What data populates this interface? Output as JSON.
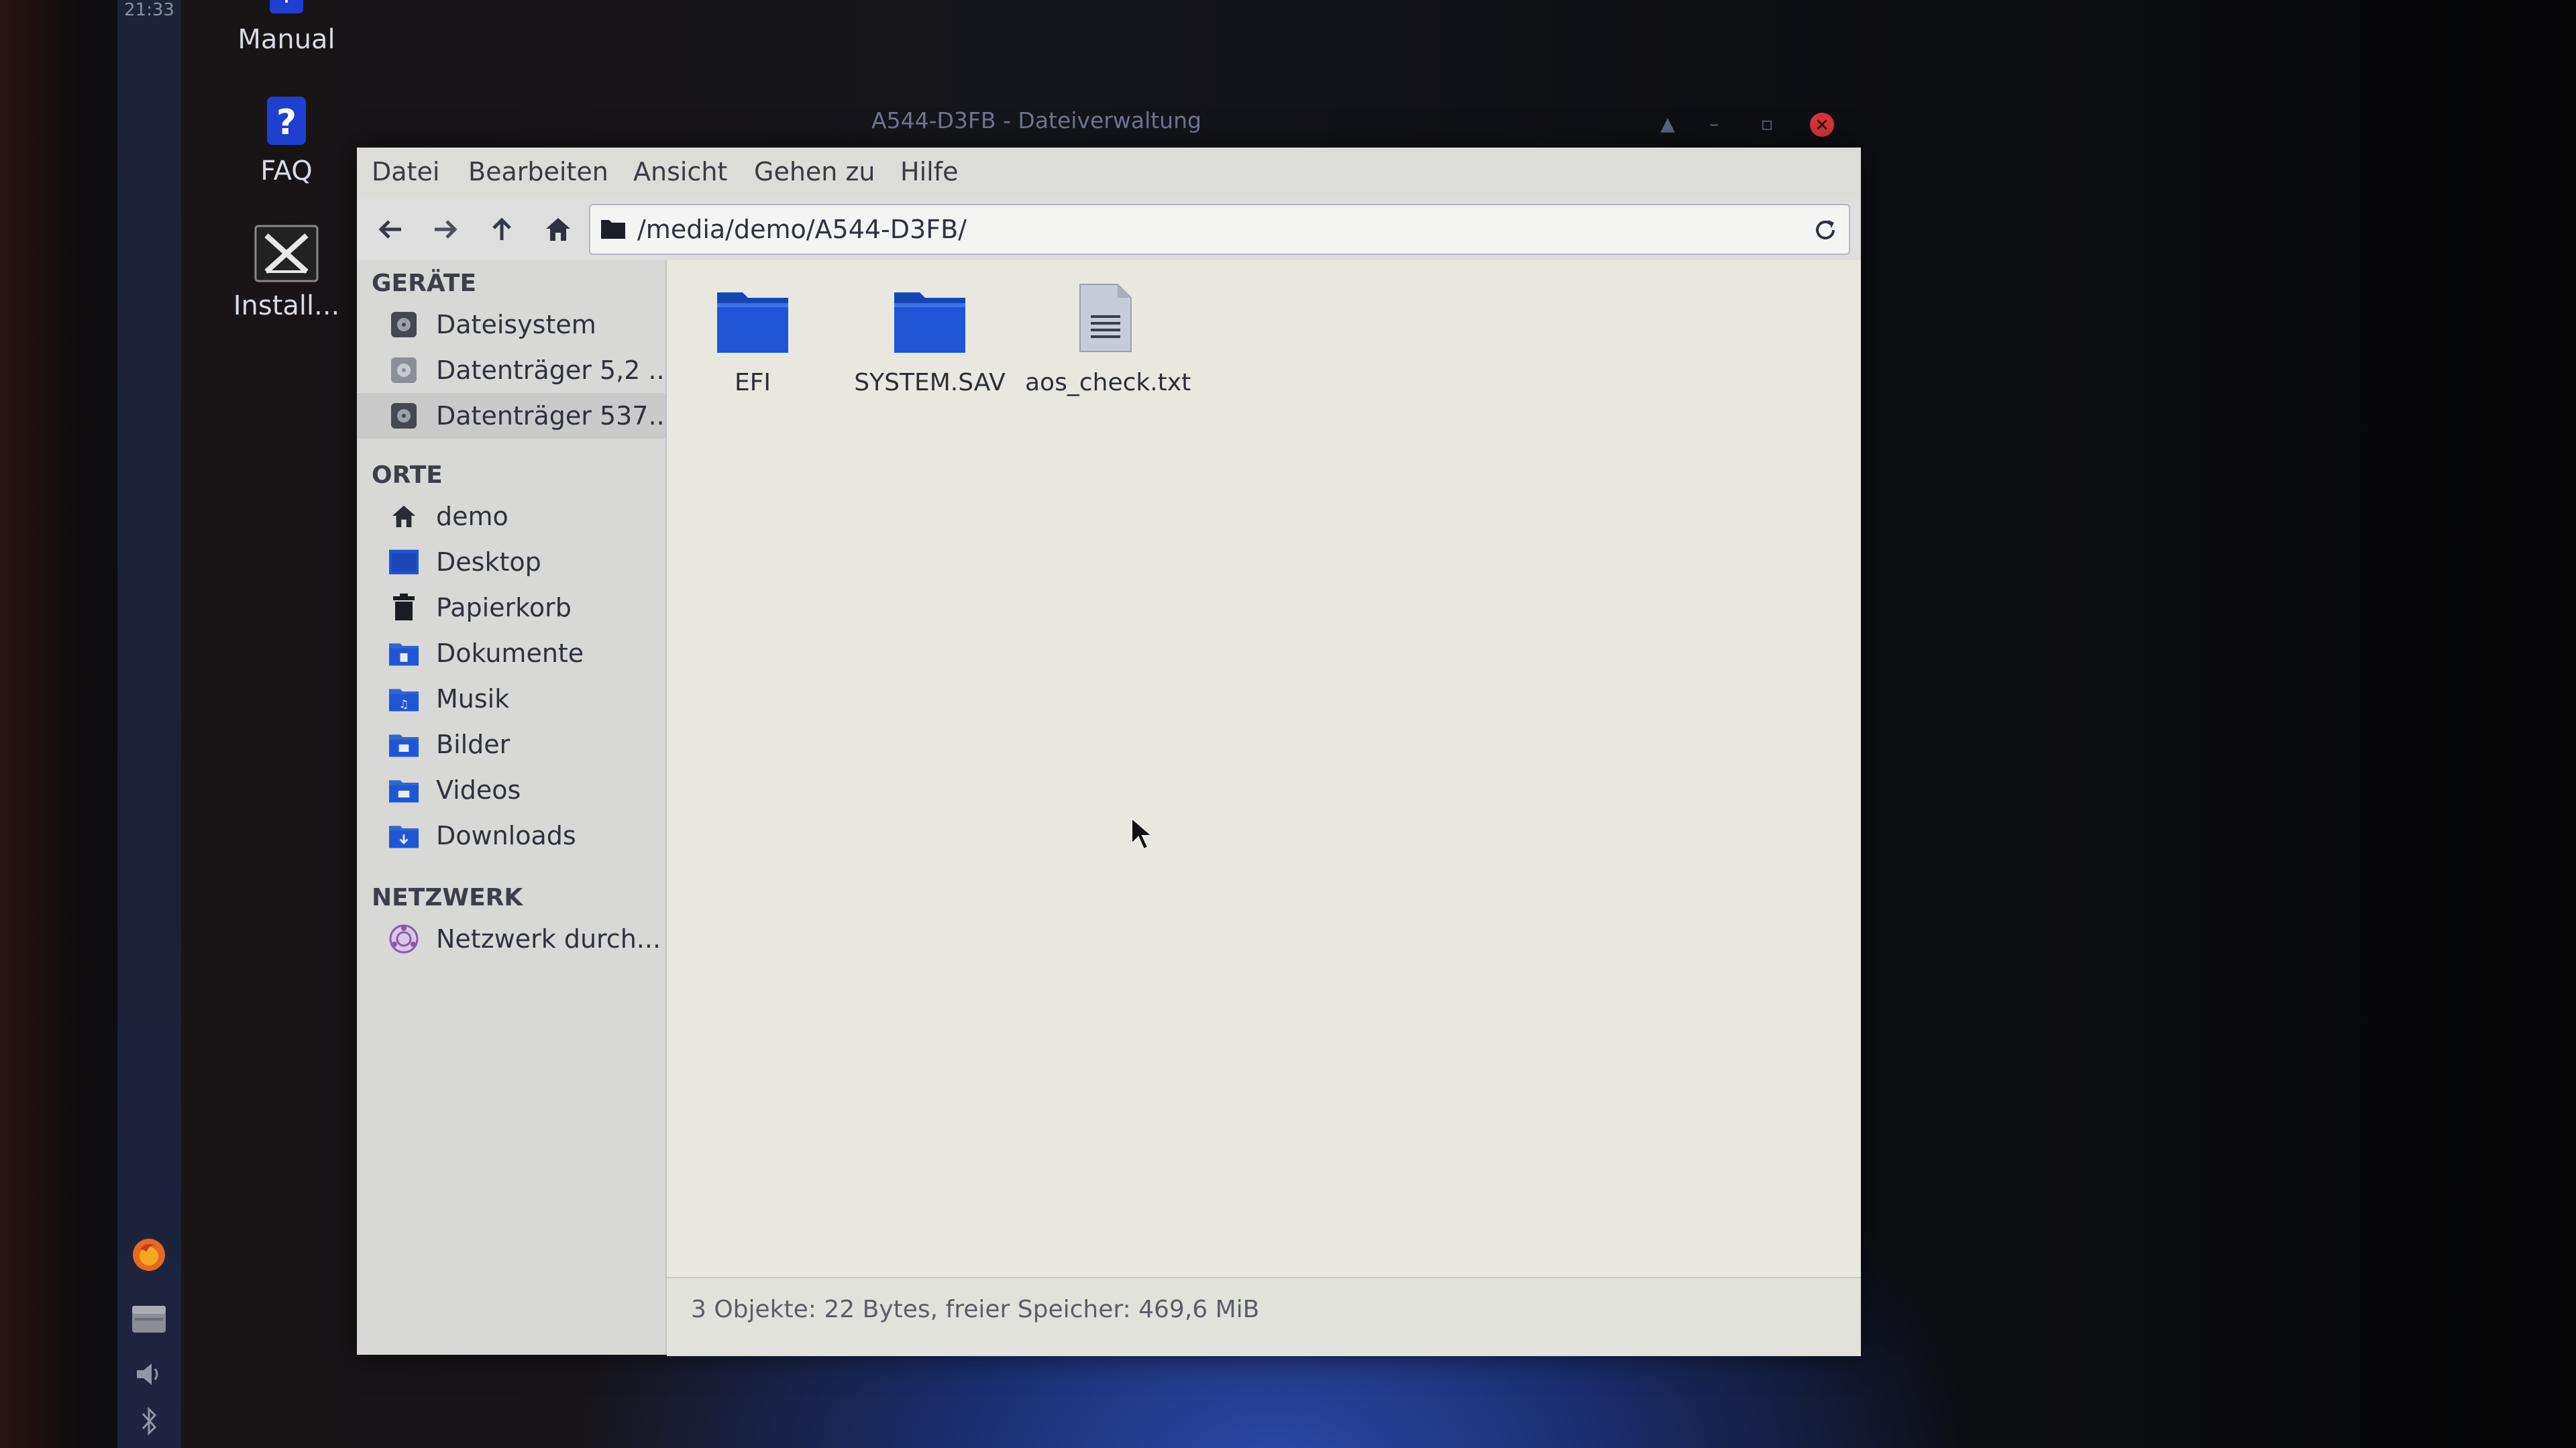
{
  "panel": {
    "clock": "21:33",
    "icons": [
      "firefox-icon",
      "file-manager-icon",
      "volume-icon",
      "bluetooth-icon"
    ]
  },
  "desktop": {
    "icons": [
      {
        "label": "Manual",
        "icon": "manual-icon"
      },
      {
        "label": "FAQ",
        "icon": "help-icon"
      },
      {
        "label": "Install...",
        "icon": "install-icon"
      }
    ]
  },
  "window": {
    "title": "A544-D3FB - Dateiverwaltung",
    "controls": [
      "eject-icon",
      "minimize-icon",
      "maximize-icon",
      "close-icon"
    ]
  },
  "menu": [
    "Datei",
    "Bearbeiten",
    "Ansicht",
    "Gehen zu",
    "Hilfe"
  ],
  "toolbar": {
    "buttons": [
      "back-arrow-icon",
      "forward-arrow-icon",
      "up-arrow-icon",
      "home-icon"
    ],
    "path": "/media/demo/A544-D3FB/"
  },
  "sidebar": {
    "sections": [
      {
        "heading": "GERÄTE",
        "items": [
          {
            "label": "Dateisystem",
            "icon": "drive-icon",
            "selected": false
          },
          {
            "label": "Datenträger 5,2 ...",
            "icon": "drive-icon",
            "selected": false
          },
          {
            "label": "Datenträger 537...",
            "icon": "drive-icon",
            "selected": true
          }
        ]
      },
      {
        "heading": "ORTE",
        "items": [
          {
            "label": "demo",
            "icon": "home-icon"
          },
          {
            "label": "Desktop",
            "icon": "desktop-folder-icon"
          },
          {
            "label": "Papierkorb",
            "icon": "trash-icon"
          },
          {
            "label": "Dokumente",
            "icon": "documents-folder-icon"
          },
          {
            "label": "Musik",
            "icon": "music-folder-icon"
          },
          {
            "label": "Bilder",
            "icon": "pictures-folder-icon"
          },
          {
            "label": "Videos",
            "icon": "videos-folder-icon"
          },
          {
            "label": "Downloads",
            "icon": "downloads-folder-icon"
          }
        ]
      },
      {
        "heading": "NETZWERK",
        "items": [
          {
            "label": "Netzwerk durch...",
            "icon": "network-icon"
          }
        ]
      }
    ]
  },
  "files": [
    {
      "name": "EFI",
      "type": "folder"
    },
    {
      "name": "SYSTEM.SAV",
      "type": "folder"
    },
    {
      "name": "aos_check.txt",
      "type": "text-file"
    }
  ],
  "status": "3 Objekte: 22 Bytes, freier Speicher: 469,6 MiB",
  "colors": {
    "folder_blue": "#1f56d6",
    "close_red": "#d8343a",
    "panel_bg": "#1e2438"
  }
}
